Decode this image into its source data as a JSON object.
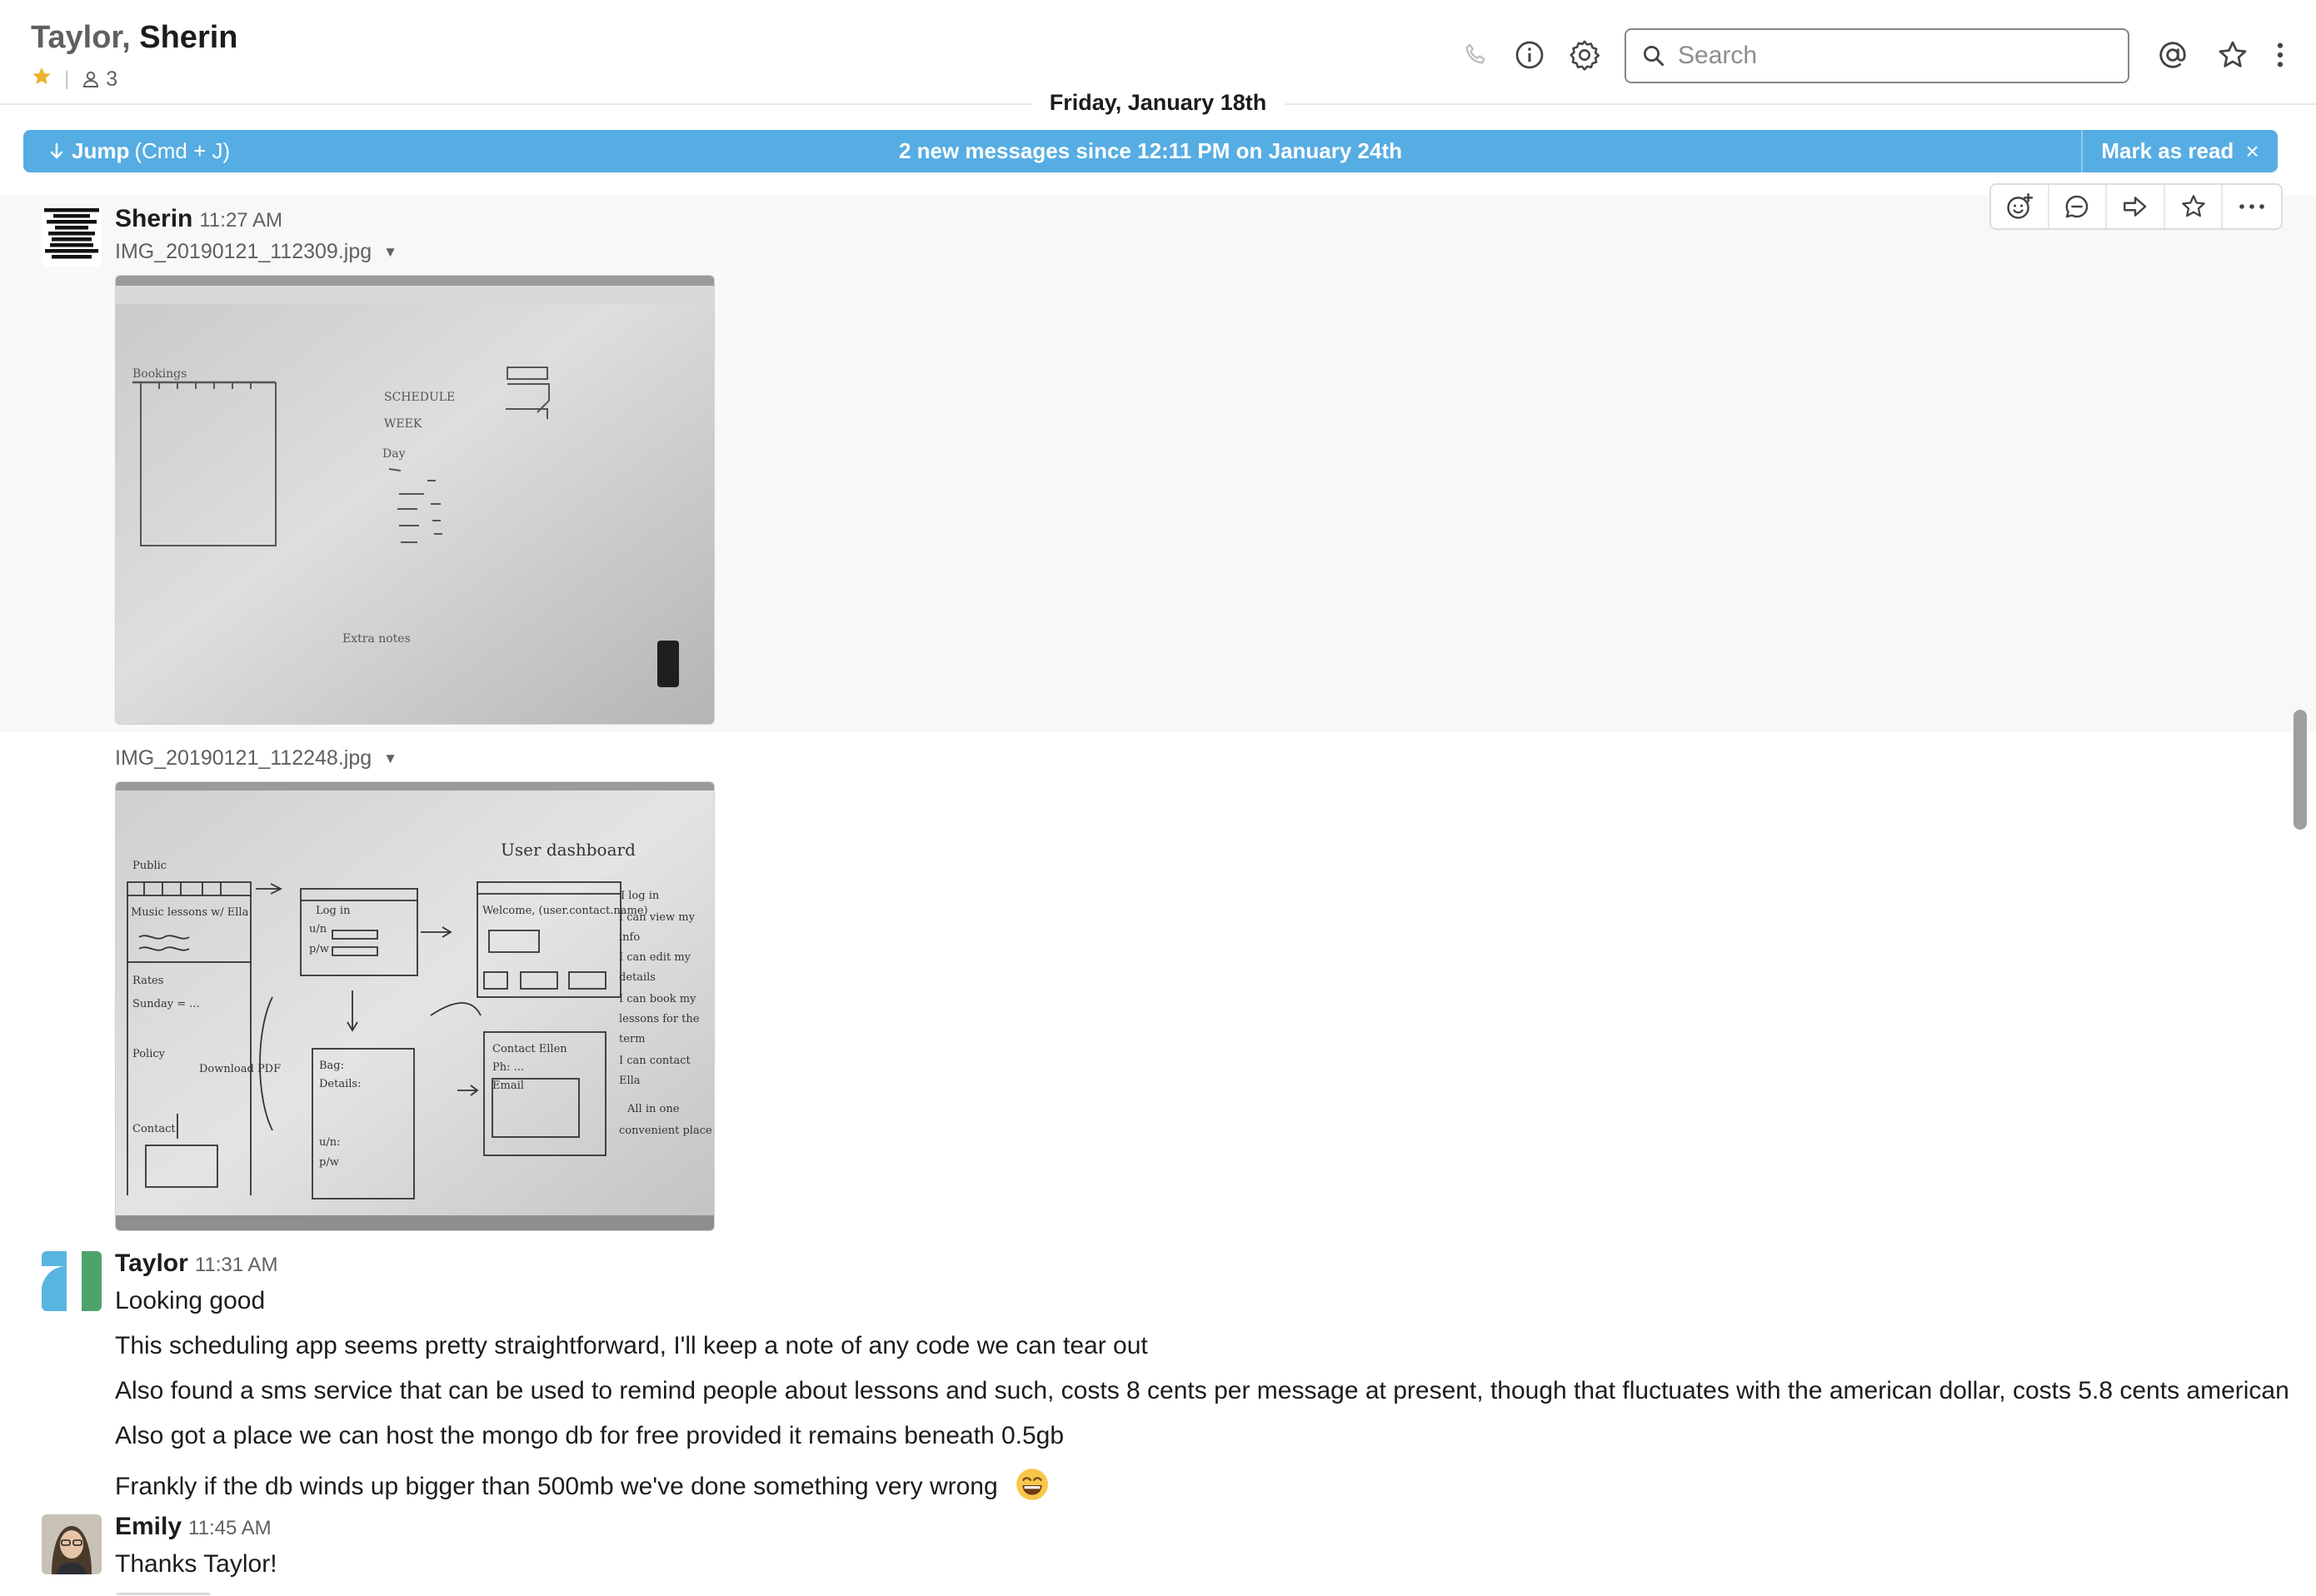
{
  "header": {
    "title_first": "Taylor,",
    "title_second": "Sherin",
    "member_count": "3",
    "search_placeholder": "Search",
    "icons": [
      "star-icon",
      "members-icon",
      "phone-icon",
      "info-icon",
      "gear-icon",
      "search-icon",
      "mention-icon",
      "starred-icon",
      "kebab-menu-icon"
    ]
  },
  "date_divider": "Friday, January 18th",
  "banner": {
    "jump_label": "Jump",
    "jump_shortcut": "(Cmd + J)",
    "center_text": "2 new messages since 12:11 PM on January 24th",
    "mark_read_label": "Mark as read",
    "close_symbol": "×",
    "color": "#56ade3"
  },
  "message_actions": [
    "add-reaction-icon",
    "reply-thread-icon",
    "share-icon",
    "star-icon",
    "more-actions-icon"
  ],
  "messages": [
    {
      "sender": "Sherin",
      "time": "11:27 AM",
      "avatar_text": "I MAY LOOK LIKE I'M HAVING DEEP THOUGHTS BUT 99% OF THE TIME I'M THINKING ABOUT WHAT I'M GOING TO EAT LATER",
      "files": [
        {
          "name": "IMG_20190121_112309.jpg"
        },
        {
          "name": "IMG_20190121_112248.jpg"
        }
      ]
    },
    {
      "sender": "Taylor",
      "time": "11:31 AM",
      "lines": [
        "Looking good",
        "This scheduling app seems pretty straightforward, I'll keep a note of any code we can tear out",
        "Also found a sms service that can be used to remind people about lessons and such, costs 8 cents per message at present, though that fluctuates with the american dollar, costs 5.8 cents american",
        "Also got a place we can host the mongo db for free provided it remains beneath 0.5gb",
        "Frankly if the db winds up bigger than 500mb we've done something very wrong"
      ],
      "emoji": "grinning-face-emoji"
    },
    {
      "sender": "Emily",
      "time": "11:45 AM",
      "lines": [
        "Thanks Taylor!"
      ]
    }
  ]
}
